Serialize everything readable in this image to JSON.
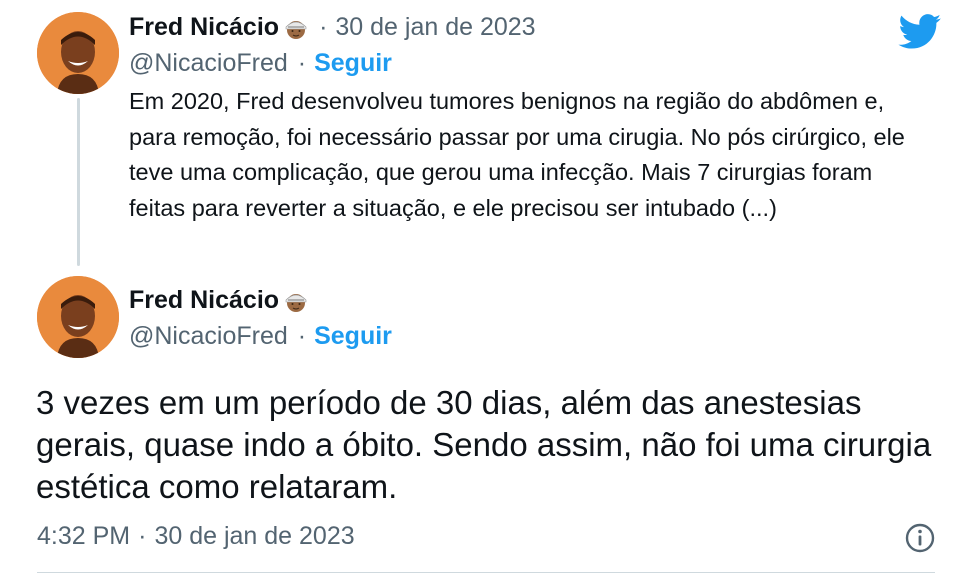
{
  "colors": {
    "link": "#1d9bf0",
    "muted": "#536471",
    "text": "#0f1419",
    "thread": "#cfd9de"
  },
  "tweet1": {
    "display_name": "Fred Nicácio",
    "emoji_icon": "firefighter-emoji-icon",
    "separator": "·",
    "date": "30 de jan de 2023",
    "handle": "@NicacioFred",
    "follow": "Seguir",
    "text": "Em 2020, Fred desenvolveu tumores benignos na região do abdômen e, para remoção, foi necessário passar por uma cirugia. No pós cirúrgico, ele teve uma complicação, que gerou uma infecção. Mais 7 cirurgias foram feitas para reverter a situação, e ele precisou ser intubado (...)"
  },
  "tweet2": {
    "display_name": "Fred Nicácio",
    "emoji_icon": "firefighter-emoji-icon",
    "handle": "@NicacioFred",
    "separator": "·",
    "follow": "Seguir",
    "text": "3 vezes em um período de 30 dias, além das anestesias gerais, quase indo a óbito. Sendo assim, não foi uma cirurgia estética como relataram.",
    "time": "4:32 PM",
    "footer_separator": "·",
    "footer_date": "30 de jan de 2023"
  },
  "icons": {
    "brand": "twitter-bird-icon",
    "info": "info-icon"
  }
}
